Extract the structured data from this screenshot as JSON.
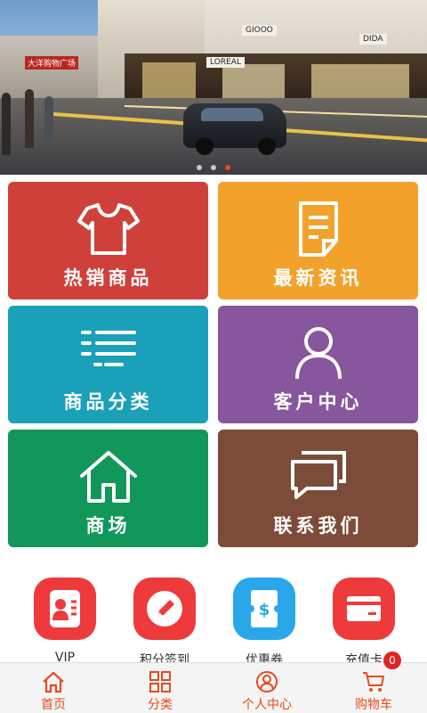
{
  "banner": {
    "slides_total": 3,
    "active_slide": 3,
    "sign_text": "大洋购物广场",
    "store_labels": [
      "GIOOO",
      "LOREAL",
      "DIDA"
    ]
  },
  "tiles": [
    {
      "label": "热销商品",
      "icon": "tshirt-icon",
      "color": "#d0403a"
    },
    {
      "label": "最新资讯",
      "icon": "document-icon",
      "color": "#f2a22a"
    },
    {
      "label": "商品分类",
      "icon": "list-icon",
      "color": "#1aa0b8"
    },
    {
      "label": "客户中心",
      "icon": "user-icon",
      "color": "#87569c"
    },
    {
      "label": "商场",
      "icon": "home-icon",
      "color": "#12975a"
    },
    {
      "label": "联系我们",
      "icon": "chat-icon",
      "color": "#7d4b39"
    }
  ],
  "quick_links": [
    {
      "label": "VIP",
      "icon": "vip-card-icon",
      "color": "#ee3a3a"
    },
    {
      "label": "积分签到",
      "icon": "pencil-icon",
      "color": "#ee3a3a"
    },
    {
      "label": "优惠券",
      "icon": "coupon-icon",
      "color": "#2aa7ea"
    },
    {
      "label": "充值卡",
      "icon": "credit-card-icon",
      "color": "#ee3a3a"
    }
  ],
  "cart_badge": "0",
  "tabbar": {
    "items": [
      {
        "label": "首页",
        "icon": "home-tab-icon"
      },
      {
        "label": "分类",
        "icon": "grid-icon"
      },
      {
        "label": "个人中心",
        "icon": "profile-icon"
      },
      {
        "label": "购物车",
        "icon": "cart-icon"
      }
    ],
    "accent": "#e8491d"
  }
}
